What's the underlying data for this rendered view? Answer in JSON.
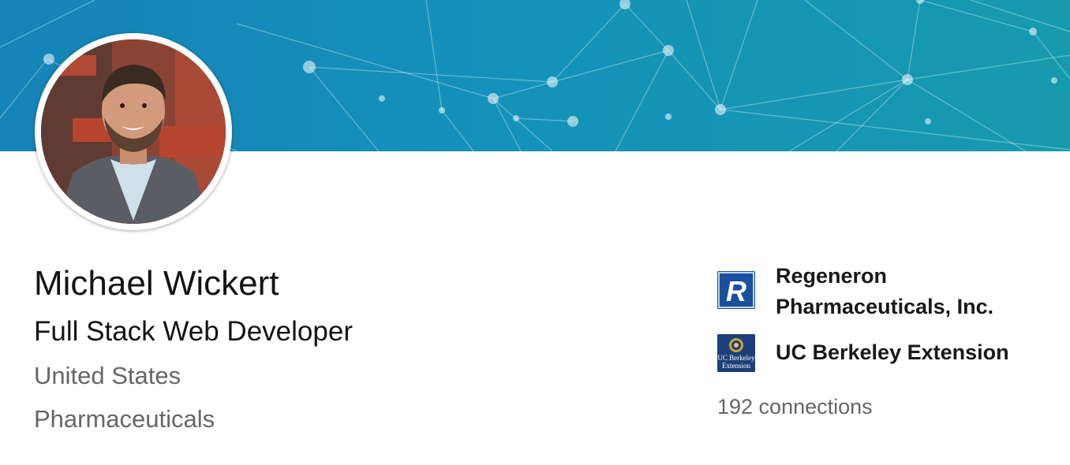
{
  "profile": {
    "name": "Michael Wickert",
    "headline": "Full Stack Web Developer",
    "location": "United States",
    "industry": "Pharmaceuticals",
    "connections": "192 connections"
  },
  "organizations": [
    {
      "name": "Regeneron Pharmaceuticals, Inc.",
      "logo_letter": "R",
      "logo_color": "#1a4f9e"
    },
    {
      "name": "UC Berkeley Extension",
      "logo_text_line1": "UC Berkeley",
      "logo_text_line2": "Extension",
      "logo_color": "#1c3e7a"
    }
  ],
  "banner": {
    "color": "#1591ba",
    "icon": "network-pattern"
  },
  "colors": {
    "text_primary": "#141414",
    "text_secondary": "#666666"
  }
}
